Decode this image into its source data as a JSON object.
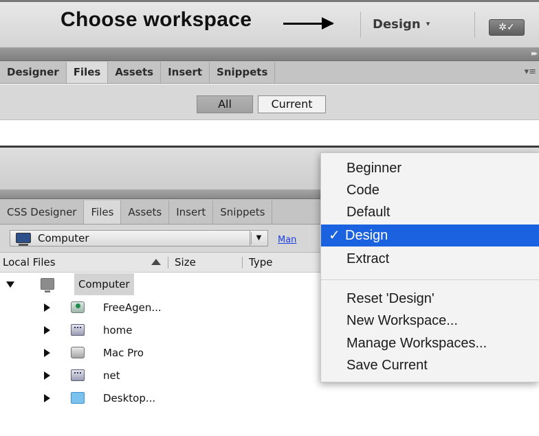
{
  "top": {
    "headline": "Choose workspace",
    "workspace_switcher": "Design",
    "tabs": [
      "Designer",
      "Files",
      "Assets",
      "Insert",
      "Snippets"
    ],
    "segments": [
      "All",
      "Current"
    ]
  },
  "bottom": {
    "tabs": [
      "CSS Designer",
      "Files",
      "Assets",
      "Insert",
      "Snippets"
    ],
    "site_select": "Computer",
    "manage_link": "Man",
    "columns": [
      "Local Files",
      "Size",
      "Type"
    ],
    "tree": [
      {
        "label": "Computer",
        "icon": "monitor-icon",
        "expanded": true,
        "selected": true
      },
      {
        "label": "FreeAgen...",
        "icon": "drive-icon"
      },
      {
        "label": "home",
        "icon": "network-drive-icon"
      },
      {
        "label": "Mac Pro",
        "icon": "hard-drive-icon"
      },
      {
        "label": "net",
        "icon": "network-drive-icon"
      },
      {
        "label": "Desktop...",
        "icon": "folder-icon"
      }
    ]
  },
  "menu": {
    "workspaces": [
      "Beginner",
      "Code",
      "Default",
      "Design",
      "Extract"
    ],
    "checked": "Design",
    "actions": [
      "Reset 'Design'",
      "New Workspace...",
      "Manage Workspaces...",
      "Save Current"
    ]
  },
  "colors": {
    "menu_highlight": "#1b62e0",
    "link": "#1a3ee0",
    "panel_gray": "#d6d6d6"
  }
}
